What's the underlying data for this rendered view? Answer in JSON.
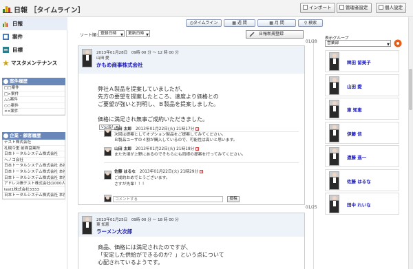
{
  "header": {
    "title": "日報 ［タイムライン］",
    "buttons": {
      "import": "インポート",
      "admin": "管理者設定",
      "personal": "個人設定"
    }
  },
  "nav": {
    "items": [
      {
        "label": "日報",
        "icon": "daily-report-icon"
      },
      {
        "label": "案件",
        "icon": "case-icon"
      },
      {
        "label": "目標",
        "icon": "target-icon"
      },
      {
        "label": "マスタメンテナンス",
        "icon": "star-icon"
      }
    ]
  },
  "cases_panel": {
    "title": "案件履歴",
    "items": [
      "□□案件",
      "□×案件",
      "△△案件",
      "○○案件",
      "××案件"
    ]
  },
  "clients_panel": {
    "title": "企業・顧客履歴",
    "items": [
      "テスト株式会社",
      "札幌今里 前面営業所",
      "日本トータルシステム株式会社",
      "ヘノコ会社",
      "日本トータルシステム株式会社 本社(札幌)",
      "日本トータルシステム株式会社 本社(札幌)",
      "日本トータルシステム株式会社 本社(札幌)4",
      "アドレス帳テスト株式会社(1000人)",
      "test1株式会社3333",
      "日本トータルシステム株式会社 本社(札幌)22"
    ]
  },
  "toolbar": {
    "timeline": "タイムライン",
    "week": "週 間",
    "month": "月 間",
    "search": "検索",
    "sort_label": "ソート順：",
    "sort_options": [
      "登録日時",
      "更新日時"
    ],
    "new_daily": "日報新規登録"
  },
  "timeline": {
    "date_marks": [
      "01/28",
      "01/25"
    ],
    "posts": [
      {
        "meta": "2013年01月28日　09時 00 分 ～ 12 時 00 分",
        "author": "山田 愛",
        "company": "かもめ商事株式会社",
        "body": [
          "弊社Ａ製品を提案していましたが、",
          "先方の要望を提案したところ、速度より価格との",
          "ご要望が強いと判明し、Ｂ製品を提案しました。",
          "",
          "価格に満足され無事ご成約いただきました。"
        ],
        "like": "いいね！",
        "comments": [
          {
            "name": "山田 太郎",
            "time": "2013年01月22日(火) 21時17分",
            "lines": [
              "次回は提案としてオプション製品をご提案してみてください。",
              "Ｂ製品ユーザの４割が購入しているので、可能性は高いと思います。"
            ]
          },
          {
            "name": "山田 太郎",
            "time": "2013年01月22日(火) 21時18分",
            "lines": [
              "また先頃が上野にあるのでそちらにも同様の提案を行ってみてください。"
            ]
          },
          {
            "name": "佐藤 はるな",
            "time": "2013年01月22日(火) 21時29分",
            "lines": [
              "ご成約おめでとうございます。",
              "さすが先輩！！！"
            ]
          }
        ],
        "comment_placeholder": "コメントする",
        "post_button": "投稿"
      },
      {
        "meta": "2013年01月25日　09時 00 分 ～ 18 時 00 分",
        "author": "東 知恵",
        "company": "ラーメン大次郎",
        "body": [
          "商品、価格には満足されたのですが、",
          "「安定した供給ができるのか？」という点について",
          "心配されているようです。"
        ]
      }
    ]
  },
  "right_panel": {
    "label": "表示グループ",
    "group": "営業部",
    "users": [
      "稗田 留美子",
      "山田 愛",
      "東 知恵",
      "伊藤 信",
      "遠藤 進一",
      "佐藤 はるな",
      "田中 れいな"
    ]
  },
  "colors": {
    "link": "#1a1ab8",
    "panel_head": "#6a87b9",
    "card_head": "#eef2f9"
  }
}
